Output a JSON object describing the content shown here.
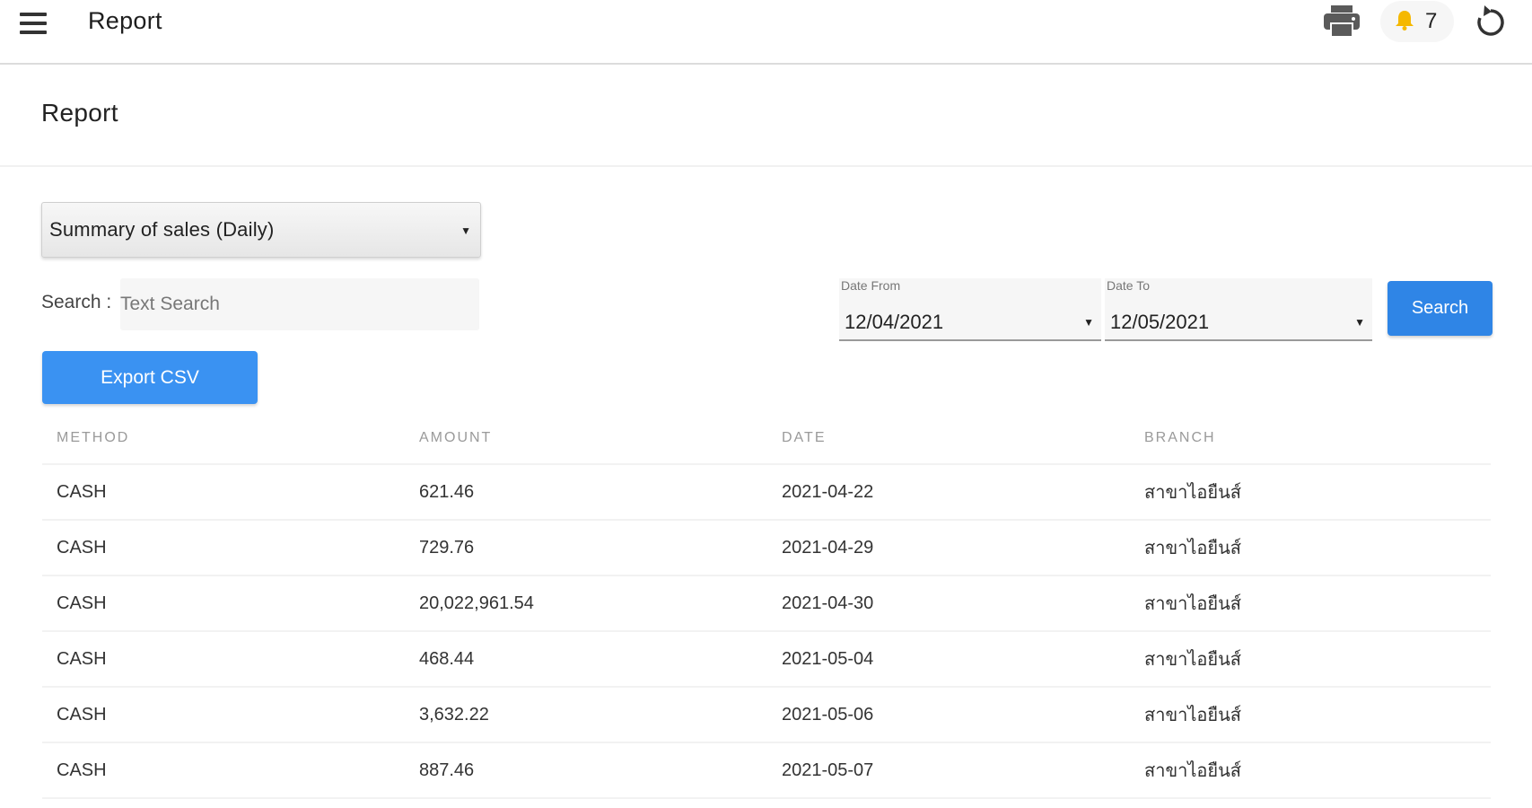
{
  "appbar": {
    "title": "Report",
    "menu_icon": "hamburger-menu-icon",
    "print_icon": "printer-icon",
    "notification_icon": "bell-icon",
    "notification_count": "7",
    "refresh_icon": "refresh-icon",
    "bell_color": "#f5b800"
  },
  "page": {
    "title": "Report"
  },
  "controls": {
    "report_type": "Summary of sales (Daily)",
    "search_label": "Search :",
    "search_placeholder": "Text Search",
    "export_label": "Export CSV",
    "date_from_label": "Date From",
    "date_from_value": "12/04/2021",
    "date_to_label": "Date To",
    "date_to_value": "12/05/2021",
    "search_button_label": "Search",
    "accent_color": "#3a92f2"
  },
  "table": {
    "headers": [
      "METHOD",
      "AMOUNT",
      "DATE",
      "BRANCH"
    ],
    "rows": [
      [
        "CASH",
        "621.46",
        "2021-04-22",
        "สาขาไอยืนส์"
      ],
      [
        "CASH",
        "729.76",
        "2021-04-29",
        "สาขาไอยืนส์"
      ],
      [
        "CASH",
        "20,022,961.54",
        "2021-04-30",
        "สาขาไอยืนส์"
      ],
      [
        "CASH",
        "468.44",
        "2021-05-04",
        "สาขาไอยืนส์"
      ],
      [
        "CASH",
        "3,632.22",
        "2021-05-06",
        "สาขาไอยืนส์"
      ],
      [
        "CASH",
        "887.46",
        "2021-05-07",
        "สาขาไอยืนส์"
      ]
    ]
  }
}
